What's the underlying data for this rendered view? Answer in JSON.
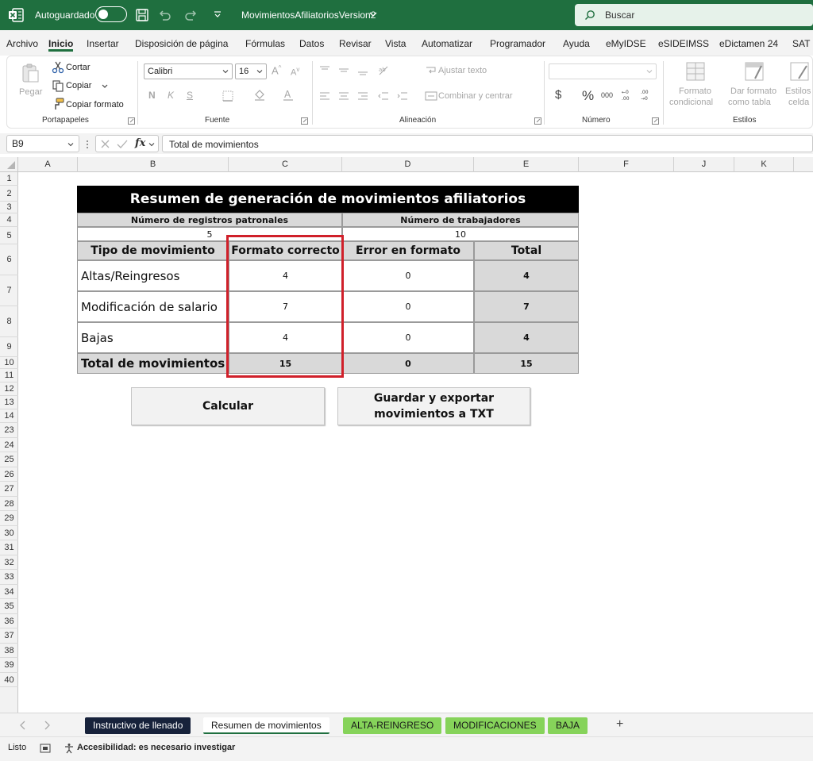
{
  "titlebar": {
    "autosave_label": "Autoguardado",
    "filename": "MovimientosAfiliatoriosVersion2",
    "search_placeholder": "Buscar"
  },
  "menu_tabs": [
    "Archivo",
    "Inicio",
    "Insertar",
    "Disposición de página",
    "Fórmulas",
    "Datos",
    "Revisar",
    "Vista",
    "Automatizar",
    "Programador",
    "Ayuda",
    "eMyIDSE",
    "eSIDEIMSS",
    "eDictamen 24",
    "SAT"
  ],
  "active_menu_tab": "Inicio",
  "ribbon": {
    "clipboard": {
      "group_label": "Portapapeles",
      "paste": "Pegar",
      "cut": "Cortar",
      "copy": "Copiar",
      "format_painter": "Copiar formato"
    },
    "font": {
      "group_label": "Fuente",
      "font_name": "Calibri",
      "font_size": "16",
      "bold": "N",
      "italic": "K",
      "underline": "S"
    },
    "alignment": {
      "group_label": "Alineación",
      "wrap_text": "Ajustar texto",
      "merge_center": "Combinar y centrar"
    },
    "number": {
      "group_label": "Número",
      "currency": "$",
      "percent": "%",
      "thousands": "000"
    },
    "styles": {
      "group_label": "Estilos",
      "conditional_1": "Formato",
      "conditional_2": "condicional",
      "table_format_1": "Dar formato",
      "table_format_2": "como tabla",
      "cell_styles_1": "Estilos de",
      "cell_styles_2": "celda"
    }
  },
  "formula_bar": {
    "name_box": "B9",
    "fx": "fx",
    "content": "Total de movimientos"
  },
  "columns": [
    "A",
    "B",
    "C",
    "D",
    "E",
    "F",
    "J",
    "K"
  ],
  "rows": [
    "1",
    "2",
    "3",
    "4",
    "5",
    "6",
    "7",
    "8",
    "9",
    "10",
    "11",
    "12",
    "13",
    "14",
    "23",
    "24",
    "25",
    "26",
    "27",
    "28",
    "29",
    "30",
    "31",
    "32",
    "33",
    "34",
    "35",
    "36",
    "37",
    "38",
    "39",
    "40"
  ],
  "summary": {
    "title": "Resumen de generación de movimientos afiliatorios",
    "employers_label": "Número de registros patronales",
    "employers_value": "5",
    "workers_label": "Número de trabajadores",
    "workers_value": "10",
    "headers": [
      "Tipo de movimiento",
      "Formato correcto",
      "Error en formato",
      "Total"
    ],
    "rows": [
      {
        "type": "Altas/Reingresos",
        "correct": "4",
        "error": "0",
        "total": "4"
      },
      {
        "type": "Modificación de salario",
        "correct": "7",
        "error": "0",
        "total": "7"
      },
      {
        "type": "Bajas",
        "correct": "4",
        "error": "0",
        "total": "4"
      }
    ],
    "total_row": {
      "type": "Total de movimientos",
      "correct": "15",
      "error": "0",
      "total": "15"
    }
  },
  "buttons": {
    "calculate": "Calcular",
    "export": "Guardar y exportar\nmovimientos a TXT"
  },
  "sheet_tabs": [
    {
      "label": "Instructivo de llenado",
      "color": "#17223b"
    },
    {
      "label": "Resumen de movimientos",
      "color": "#ffffff"
    },
    {
      "label": "ALTA-REINGRESO",
      "color": "#86d35a"
    },
    {
      "label": "MODIFICACIONES",
      "color": "#86d35a"
    },
    {
      "label": "BAJA",
      "color": "#86d35a"
    }
  ],
  "add_sheet": "+",
  "status": {
    "ready": "Listo",
    "accessibility": "Accesibilidad: es necesario investigar"
  },
  "colors": {
    "brand": "#1f6f3f",
    "highlight": "#d0202a",
    "sheet_tab_green": "#86d35a"
  },
  "icons": [
    "excel-logo-icon",
    "save-icon",
    "undo-icon",
    "redo-icon",
    "customize-icon",
    "chevron-down-icon",
    "search-icon",
    "paste-icon",
    "cut-icon",
    "copy-icon",
    "format-painter-icon",
    "fill-color-icon",
    "font-color-icon",
    "borders-icon",
    "wrap-icon",
    "merge-icon",
    "conditional-format-icon",
    "table-format-icon",
    "cell-styles-icon",
    "cancel-icon",
    "confirm-icon",
    "macro-icon",
    "accessibility-icon"
  ]
}
